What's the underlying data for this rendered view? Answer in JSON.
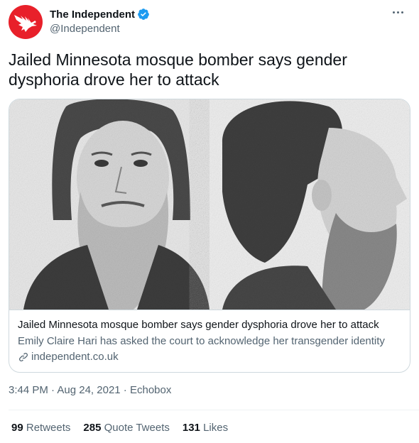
{
  "author": {
    "display_name": "The Independent",
    "handle": "@Independent",
    "verified": true,
    "avatar_icon": "independent-eagle-logo",
    "avatar_color": "#e8202a"
  },
  "tweet": {
    "text": "Jailed Minnesota mosque bomber says gender dysphoria drove her to attack"
  },
  "card": {
    "image_alt": "mugshot-front-and-profile",
    "title": "Jailed Minnesota mosque bomber says gender dysphoria drove her to attack",
    "description": "Emily Claire Hari has asked the court to acknowledge her transgender identity",
    "domain": "independent.co.uk"
  },
  "meta": {
    "time": "3:44 PM",
    "dot1": " · ",
    "date": "Aug 24, 2021",
    "dot2": " · ",
    "source": "Echobox"
  },
  "stats": {
    "retweets_count": "99",
    "retweets_label": "Retweets",
    "quotes_count": "285",
    "quotes_label": "Quote Tweets",
    "likes_count": "131",
    "likes_label": "Likes"
  },
  "colors": {
    "verified_blue": "#1d9bf0",
    "secondary_text": "#536471",
    "border": "#cfd9de"
  }
}
